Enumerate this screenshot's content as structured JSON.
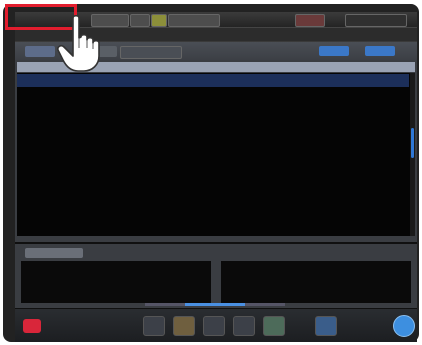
{
  "app": {
    "title": "",
    "menu_label": ""
  },
  "tabs": {
    "list_tab": "",
    "tab_2": ""
  },
  "grid": {
    "columns": [
      "",
      "",
      "",
      "",
      "",
      "",
      ""
    ],
    "rows": [
      {
        "c1": "",
        "c2": "",
        "c3": "",
        "c4": "",
        "c5": "",
        "c6": "",
        "c7": ""
      }
    ]
  },
  "info": {
    "tab_label": ""
  },
  "colors": {
    "highlight": "#e21d2e",
    "accent": "#3b78c8",
    "exit": "#d9263a"
  },
  "icons": [
    "hand-pointer-icon",
    "exit-icon",
    "toolbar-icon",
    "round-action-icon"
  ]
}
